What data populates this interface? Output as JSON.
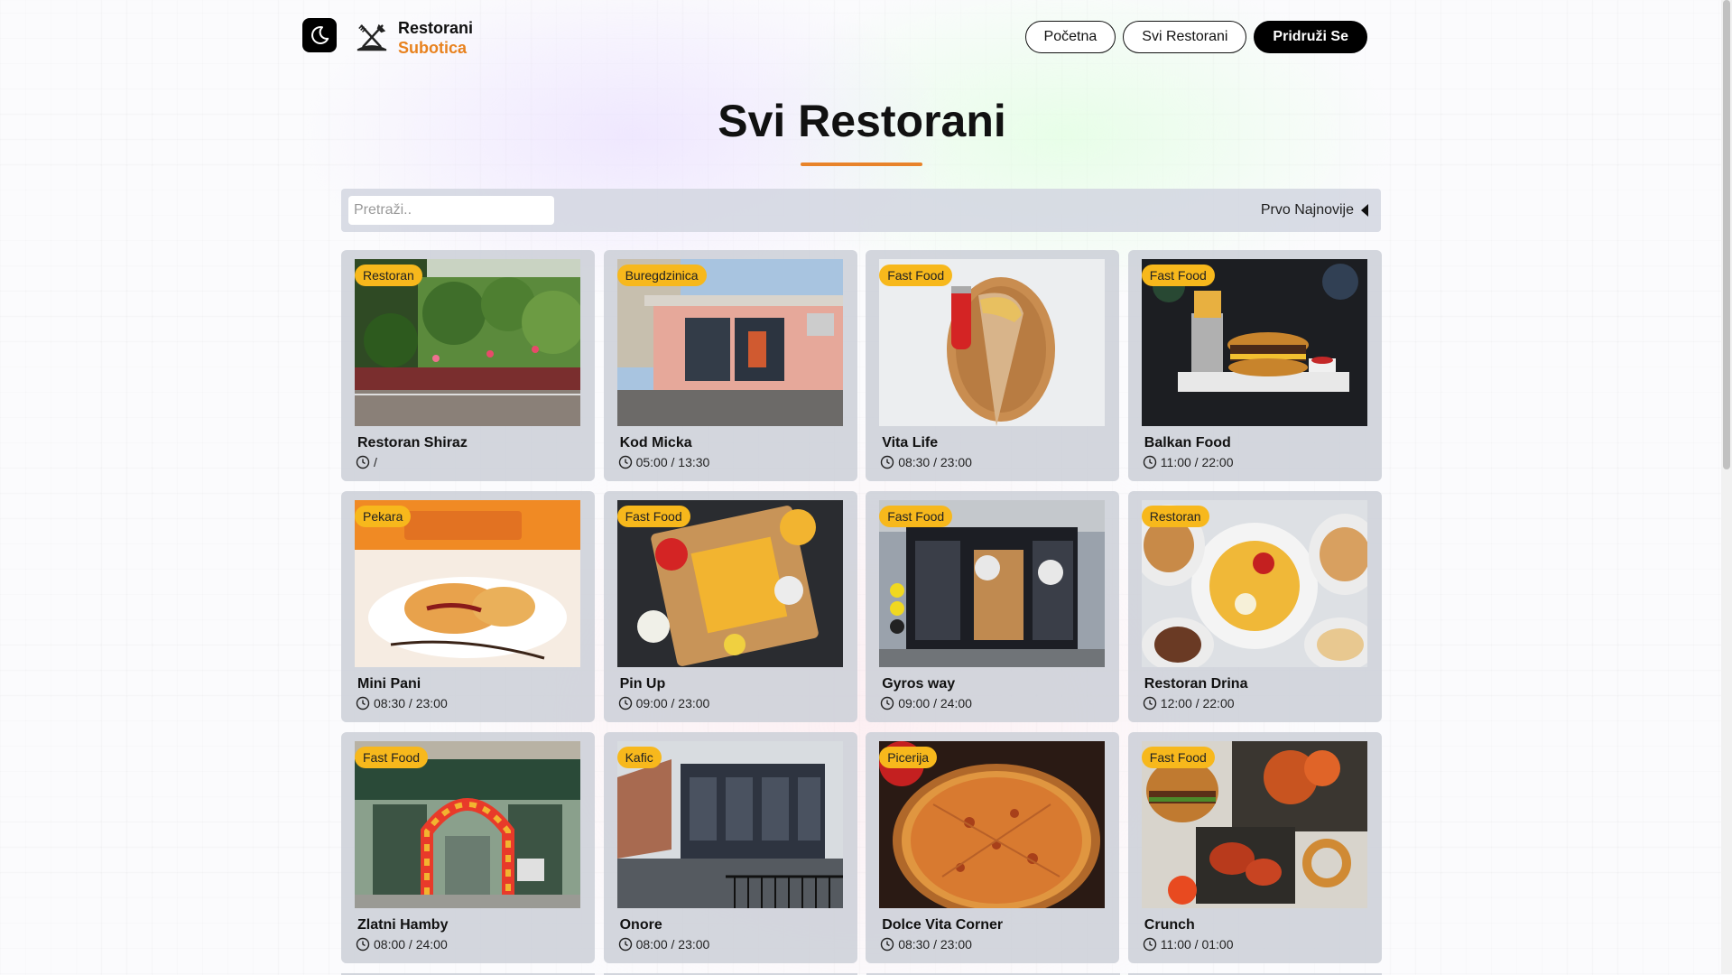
{
  "header": {
    "theme_toggle_icon": "moon-icon",
    "logo_icon": "fork-knife-icon",
    "logo_line1": "Restorani",
    "logo_line2": "Subotica",
    "nav": [
      {
        "label": "Početna"
      },
      {
        "label": "Svi Restorani"
      },
      {
        "label": "Pridruži Se"
      }
    ]
  },
  "page": {
    "title": "Svi Restorani"
  },
  "toolbar": {
    "search_placeholder": "Pretraži..",
    "sort_label": "Prvo Najnovije"
  },
  "colors": {
    "accent": "#e8832a",
    "badge": "#f7b81c",
    "primary_button": "#000000"
  },
  "restaurants": [
    {
      "name": "Restoran Shiraz",
      "category": "Restoran",
      "hours": "/",
      "image": "terrace-with-plants"
    },
    {
      "name": "Kod Micka",
      "category": "Buregdzinica",
      "hours": "05:00 / 13:30",
      "image": "pink-shop-building"
    },
    {
      "name": "Vita Life",
      "category": "Fast Food",
      "hours": "08:30 / 23:00",
      "image": "wrap-and-cola"
    },
    {
      "name": "Balkan Food",
      "category": "Fast Food",
      "hours": "11:00 / 22:00",
      "image": "burger-and-fries"
    },
    {
      "name": "Mini Pani",
      "category": "Pekara",
      "hours": "08:30 / 23:00",
      "image": "pastry-plate"
    },
    {
      "name": "Pin Up",
      "category": "Fast Food",
      "hours": "09:00 / 23:00",
      "image": "fries-platter"
    },
    {
      "name": "Gyros way",
      "category": "Fast Food",
      "hours": "09:00 / 24:00",
      "image": "gyros-storefront"
    },
    {
      "name": "Restoran Drina",
      "category": "Restoran",
      "hours": "12:00 / 22:00",
      "image": "fries-and-chicken"
    },
    {
      "name": "Zlatni Hamby",
      "category": "Fast Food",
      "hours": "08:00 / 24:00",
      "image": "storefront-balloons"
    },
    {
      "name": "Onore",
      "category": "Kafic",
      "hours": "08:00 / 23:00",
      "image": "cafe-building"
    },
    {
      "name": "Dolce Vita Corner",
      "category": "Picerija",
      "hours": "08:30 / 23:00",
      "image": "pizza"
    },
    {
      "name": "Crunch",
      "category": "Fast Food",
      "hours": "11:00 / 01:00",
      "image": "burger-wings-rings"
    }
  ]
}
